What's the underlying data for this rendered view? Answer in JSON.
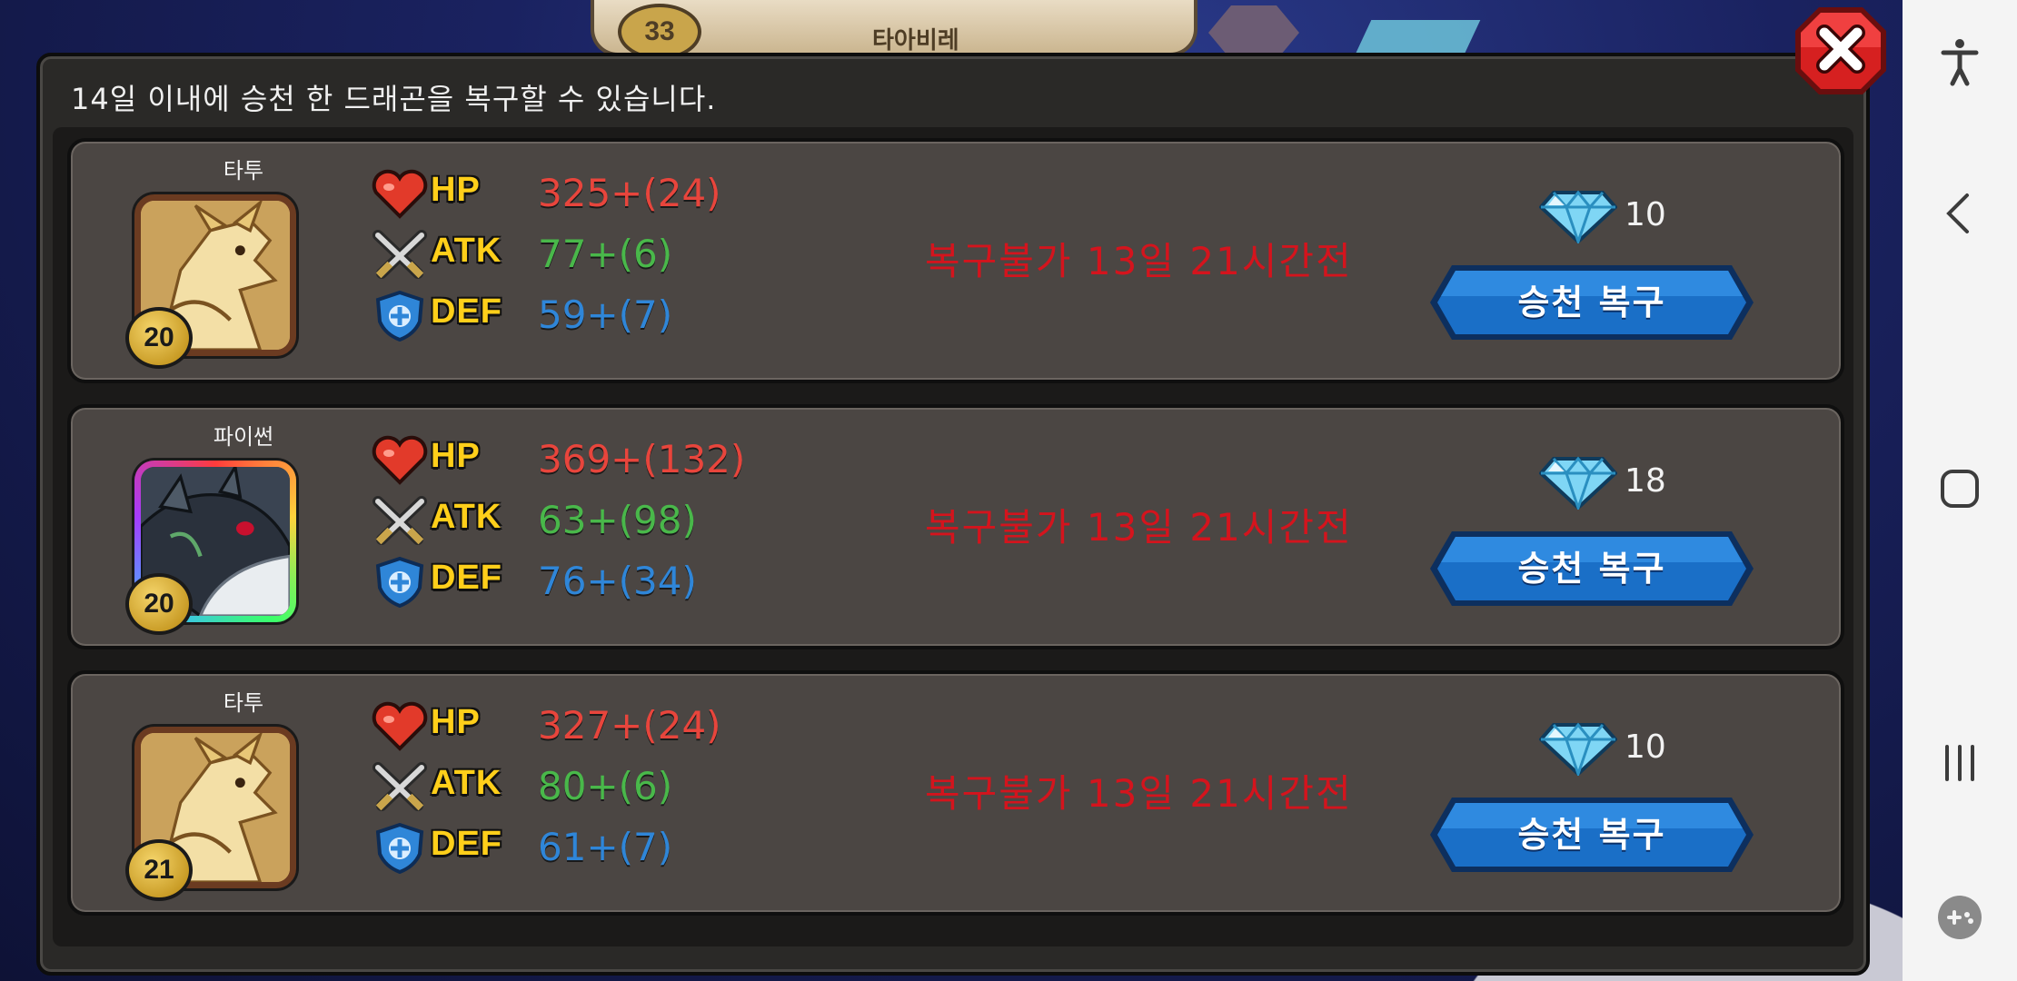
{
  "background": {
    "level_badge": "33",
    "title": "타아비레"
  },
  "dialog": {
    "notice": "14일 이내에 승천 한 드래곤을 복구할 수 있습니다.",
    "close_icon": "close-x-icon"
  },
  "stat_labels": {
    "hp": "HP",
    "atk": "ATK",
    "def": "DEF"
  },
  "dragons": [
    {
      "name": "타투",
      "level": "20",
      "frame": "bronze",
      "hp": "325+(24)",
      "atk": "77+(6)",
      "def": "59+(7)",
      "status": "복구불가 13일 21시간전",
      "cost": "10",
      "button_label": "승천 복구"
    },
    {
      "name": "파이썬",
      "level": "20",
      "frame": "rainbow",
      "hp": "369+(132)",
      "atk": "63+(98)",
      "def": "76+(34)",
      "status": "복구불가 13일 21시간전",
      "cost": "18",
      "button_label": "승천 복구"
    },
    {
      "name": "타투",
      "level": "21",
      "frame": "bronze",
      "hp": "327+(24)",
      "atk": "80+(6)",
      "def": "61+(7)",
      "status": "복구불가 13일 21시간전",
      "cost": "10",
      "button_label": "승천 복구"
    }
  ],
  "colors": {
    "hp_value": "#e8453c",
    "atk_value": "#49b84a",
    "def_value": "#2f86d8",
    "status": "#d4141d",
    "button": "#1565c0"
  },
  "nav_bar": {
    "icons": [
      "accessibility-icon",
      "back-icon",
      "home-icon",
      "recents-icon",
      "game-tools-icon"
    ]
  }
}
